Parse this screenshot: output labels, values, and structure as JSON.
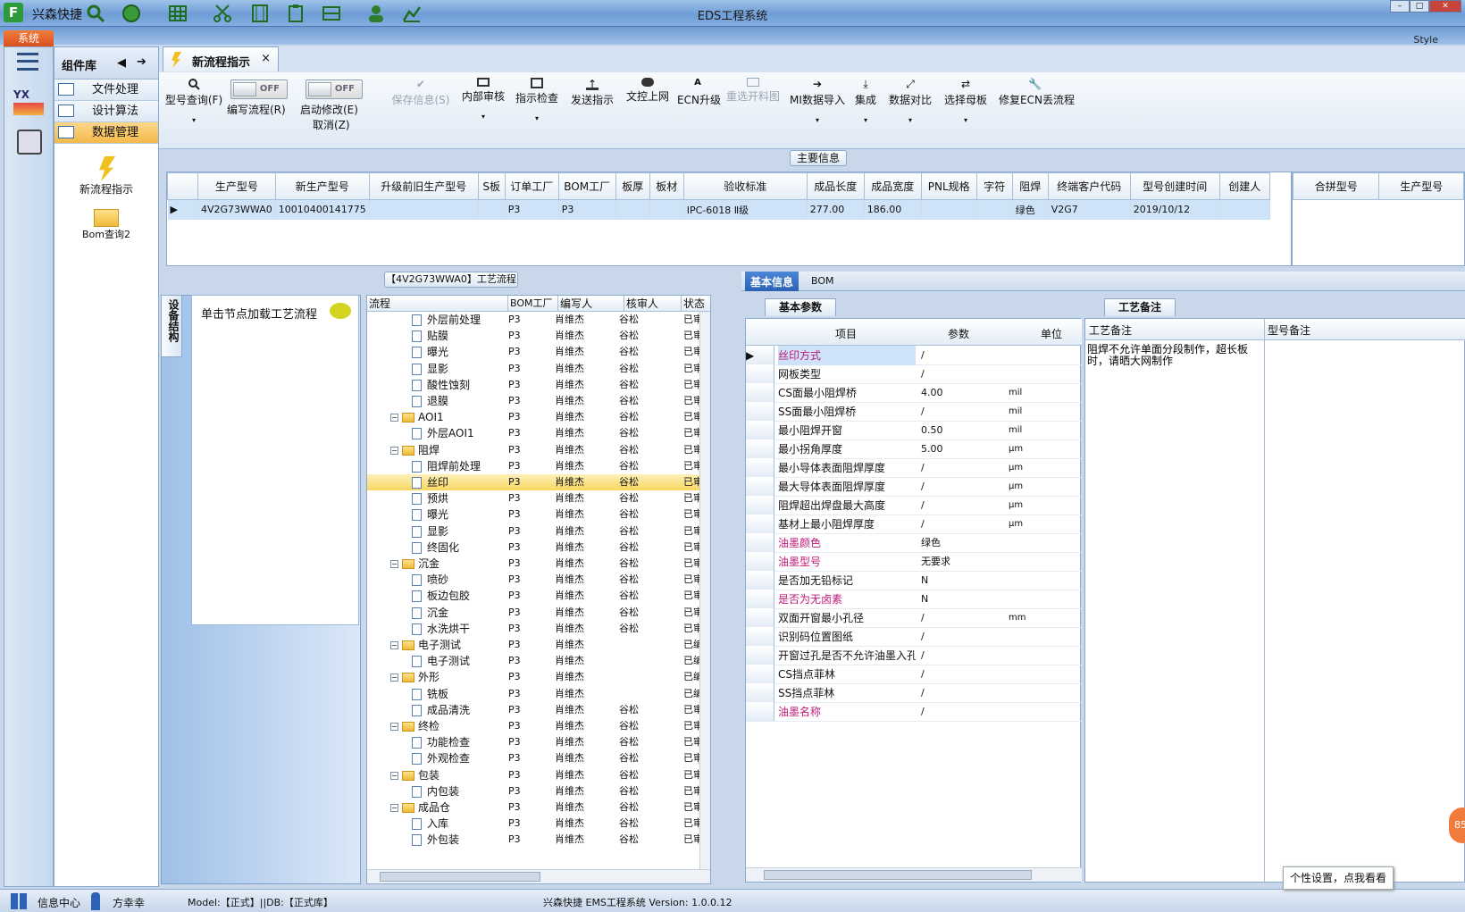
{
  "window": {
    "title": "EDS工程系统",
    "app_name": "兴森快捷",
    "style_label": "Style"
  },
  "ribbon": {
    "system_tab": "系统"
  },
  "component_panel": {
    "title": "组件库",
    "items": [
      "文件处理",
      "设计算法",
      "数据管理"
    ],
    "tools": [
      "新流程指示",
      "Bom查询2"
    ]
  },
  "document_tab": {
    "label": "新流程指示",
    "close": "×"
  },
  "toolbar": {
    "model_query": "型号查询(F)",
    "edit_flow": "编写流程(R)",
    "start_modify": "启动修改(E)",
    "cancel": "取消(Z)",
    "toggle_off": "OFF",
    "save_info": "保存信息(S)",
    "internal_review": "内部审核",
    "instruction_check": "指示检查",
    "send_instruction": "发送指示",
    "doc_upload": "文控上网",
    "ecn_upgrade": "ECN升级",
    "reselect_drawing": "重选开料图",
    "mi_import": "MI数据导入",
    "integration": "集成",
    "data_compare": "数据对比",
    "select_mother": "选择母板",
    "fix_ecn": "修复ECN丢流程"
  },
  "main_info": {
    "section_title": "主要信息",
    "columns": [
      "生产型号",
      "新生产型号",
      "升级前旧生产型号",
      "S板",
      "订单工厂",
      "BOM工厂",
      "板厚",
      "板材",
      "验收标准",
      "成品长度",
      "成品宽度",
      "PNL规格",
      "字符",
      "阻焊",
      "终端客户代码",
      "型号创建时间",
      "创建人"
    ],
    "row": [
      "4V2G73WWA0",
      "10010400141775",
      "",
      "",
      "P3",
      "P3",
      "",
      "",
      "IPC-6018 Ⅱ级",
      "277.00",
      "186.00",
      "",
      "",
      "绿色",
      "V2G7",
      "2019/10/12",
      ""
    ],
    "side_columns": [
      "合拼型号",
      "生产型号"
    ]
  },
  "process": {
    "section_title": "【4V2G73WWA0】工艺流程",
    "vertical_tab": "设备结构",
    "hint": "单击节点加载工艺流程",
    "columns": [
      "流程",
      "BOM工厂",
      "编写人",
      "核审人",
      "状态"
    ],
    "rows": [
      {
        "name": "外层前处理",
        "factory": "P3",
        "writer": "肖维杰",
        "reviewer": "谷松",
        "status": "已审核",
        "folder": false
      },
      {
        "name": "贴膜",
        "factory": "P3",
        "writer": "肖维杰",
        "reviewer": "谷松",
        "status": "已审核",
        "folder": false
      },
      {
        "name": "曝光",
        "factory": "P3",
        "writer": "肖维杰",
        "reviewer": "谷松",
        "status": "已审核",
        "folder": false
      },
      {
        "name": "显影",
        "factory": "P3",
        "writer": "肖维杰",
        "reviewer": "谷松",
        "status": "已审核",
        "folder": false
      },
      {
        "name": "酸性蚀刻",
        "factory": "P3",
        "writer": "肖维杰",
        "reviewer": "谷松",
        "status": "已审核",
        "folder": false
      },
      {
        "name": "退膜",
        "factory": "P3",
        "writer": "肖维杰",
        "reviewer": "谷松",
        "status": "已审核",
        "folder": false
      },
      {
        "name": "AOI1",
        "factory": "P3",
        "writer": "肖维杰",
        "reviewer": "谷松",
        "status": "已审核",
        "folder": true
      },
      {
        "name": "外层AOI1",
        "factory": "P3",
        "writer": "肖维杰",
        "reviewer": "谷松",
        "status": "已审核",
        "folder": false
      },
      {
        "name": "阻焊",
        "factory": "P3",
        "writer": "肖维杰",
        "reviewer": "谷松",
        "status": "已审核",
        "folder": true
      },
      {
        "name": "阻焊前处理",
        "factory": "P3",
        "writer": "肖维杰",
        "reviewer": "谷松",
        "status": "已审核",
        "folder": false
      },
      {
        "name": "丝印",
        "factory": "P3",
        "writer": "肖维杰",
        "reviewer": "谷松",
        "status": "已审核",
        "folder": false
      },
      {
        "name": "预烘",
        "factory": "P3",
        "writer": "肖维杰",
        "reviewer": "谷松",
        "status": "已审核",
        "folder": false
      },
      {
        "name": "曝光",
        "factory": "P3",
        "writer": "肖维杰",
        "reviewer": "谷松",
        "status": "已审核",
        "folder": false
      },
      {
        "name": "显影",
        "factory": "P3",
        "writer": "肖维杰",
        "reviewer": "谷松",
        "status": "已审核",
        "folder": false
      },
      {
        "name": "终固化",
        "factory": "P3",
        "writer": "肖维杰",
        "reviewer": "谷松",
        "status": "已审核",
        "folder": false
      },
      {
        "name": "沉金",
        "factory": "P3",
        "writer": "肖维杰",
        "reviewer": "谷松",
        "status": "已审核",
        "folder": true
      },
      {
        "name": "喷砂",
        "factory": "P3",
        "writer": "肖维杰",
        "reviewer": "谷松",
        "status": "已审核",
        "folder": false
      },
      {
        "name": "板边包胶",
        "factory": "P3",
        "writer": "肖维杰",
        "reviewer": "谷松",
        "status": "已审核",
        "folder": false
      },
      {
        "name": "沉金",
        "factory": "P3",
        "writer": "肖维杰",
        "reviewer": "谷松",
        "status": "已审核",
        "folder": false
      },
      {
        "name": "水洗烘干",
        "factory": "P3",
        "writer": "肖维杰",
        "reviewer": "谷松",
        "status": "已审核",
        "folder": false
      },
      {
        "name": "电子测试",
        "factory": "P3",
        "writer": "肖维杰",
        "reviewer": "",
        "status": "已编写",
        "folder": true
      },
      {
        "name": "电子测试",
        "factory": "P3",
        "writer": "肖维杰",
        "reviewer": "",
        "status": "已编写",
        "folder": false
      },
      {
        "name": "外形",
        "factory": "P3",
        "writer": "肖维杰",
        "reviewer": "",
        "status": "已编写",
        "folder": true
      },
      {
        "name": "铣板",
        "factory": "P3",
        "writer": "肖维杰",
        "reviewer": "",
        "status": "已编写",
        "folder": false
      },
      {
        "name": "成品清洗",
        "factory": "P3",
        "writer": "肖维杰",
        "reviewer": "谷松",
        "status": "已审核",
        "folder": false
      },
      {
        "name": "终检",
        "factory": "P3",
        "writer": "肖维杰",
        "reviewer": "谷松",
        "status": "已审核",
        "folder": true
      },
      {
        "name": "功能检查",
        "factory": "P3",
        "writer": "肖维杰",
        "reviewer": "谷松",
        "status": "已审核",
        "folder": false
      },
      {
        "name": "外观检查",
        "factory": "P3",
        "writer": "肖维杰",
        "reviewer": "谷松",
        "status": "已审核",
        "folder": false
      },
      {
        "name": "包装",
        "factory": "P3",
        "writer": "肖维杰",
        "reviewer": "谷松",
        "status": "已审核",
        "folder": true
      },
      {
        "name": "内包装",
        "factory": "P3",
        "writer": "肖维杰",
        "reviewer": "谷松",
        "status": "已审核",
        "folder": false
      },
      {
        "name": "成品仓",
        "factory": "P3",
        "writer": "肖维杰",
        "reviewer": "谷松",
        "status": "已审核",
        "folder": true
      },
      {
        "name": "入库",
        "factory": "P3",
        "writer": "肖维杰",
        "reviewer": "谷松",
        "status": "已审核",
        "folder": false
      },
      {
        "name": "外包装",
        "factory": "P3",
        "writer": "肖维杰",
        "reviewer": "谷松",
        "status": "已审核",
        "folder": false
      }
    ],
    "selected_index": 10
  },
  "detail": {
    "tabs": [
      "基本信息",
      "BOM"
    ],
    "param_tab": "基本参数",
    "remark_tab": "工艺备注",
    "param_columns": [
      "项目",
      "参数",
      "单位"
    ],
    "params": [
      {
        "item": "丝印方式",
        "value": "/",
        "unit": "",
        "pink": true
      },
      {
        "item": "网板类型",
        "value": "/",
        "unit": "",
        "pink": false
      },
      {
        "item": "CS面最小阻焊桥",
        "value": "4.00",
        "unit": "mil",
        "pink": false
      },
      {
        "item": "SS面最小阻焊桥",
        "value": "/",
        "unit": "mil",
        "pink": false
      },
      {
        "item": "最小阻焊开窗",
        "value": "0.50",
        "unit": "mil",
        "pink": false
      },
      {
        "item": "最小拐角厚度",
        "value": "5.00",
        "unit": "μm",
        "pink": false
      },
      {
        "item": "最小导体表面阻焊厚度",
        "value": "/",
        "unit": "μm",
        "pink": false
      },
      {
        "item": "最大导体表面阻焊厚度",
        "value": "/",
        "unit": "μm",
        "pink": false
      },
      {
        "item": "阻焊超出焊盘最大高度",
        "value": "/",
        "unit": "μm",
        "pink": false
      },
      {
        "item": "基材上最小阻焊厚度",
        "value": "/",
        "unit": "μm",
        "pink": false
      },
      {
        "item": "油墨颜色",
        "value": "绿色",
        "unit": "",
        "pink": true
      },
      {
        "item": "油墨型号",
        "value": "无要求",
        "unit": "",
        "pink": true
      },
      {
        "item": "是否加无铅标记",
        "value": "N",
        "unit": "",
        "pink": false
      },
      {
        "item": "是否为无卤素",
        "value": "N",
        "unit": "",
        "pink": true
      },
      {
        "item": "双面开窗最小孔径",
        "value": "/",
        "unit": "mm",
        "pink": false
      },
      {
        "item": "识别码位置图纸",
        "value": "/",
        "unit": "",
        "pink": false
      },
      {
        "item": "开窗过孔是否不允许油墨入孔",
        "value": "/",
        "unit": "",
        "pink": false
      },
      {
        "item": "CS挡点菲林",
        "value": "/",
        "unit": "",
        "pink": false
      },
      {
        "item": "SS挡点菲林",
        "value": "/",
        "unit": "",
        "pink": false
      },
      {
        "item": "油墨名称",
        "value": "/",
        "unit": "",
        "pink": true
      }
    ],
    "remark_columns": [
      "工艺备注",
      "型号备注"
    ],
    "process_remark": "阻焊不允许单面分段制作，超长板时，请晒大网制作"
  },
  "status": {
    "info_center": "信息中心",
    "user": "方幸幸",
    "model_db": "Model:【正式】||DB:【正式库】",
    "version": "兴森快捷 EMS工程系统 Version: 1.0.0.12",
    "tooltip": "个性设置，点我看看",
    "badge": "85"
  }
}
